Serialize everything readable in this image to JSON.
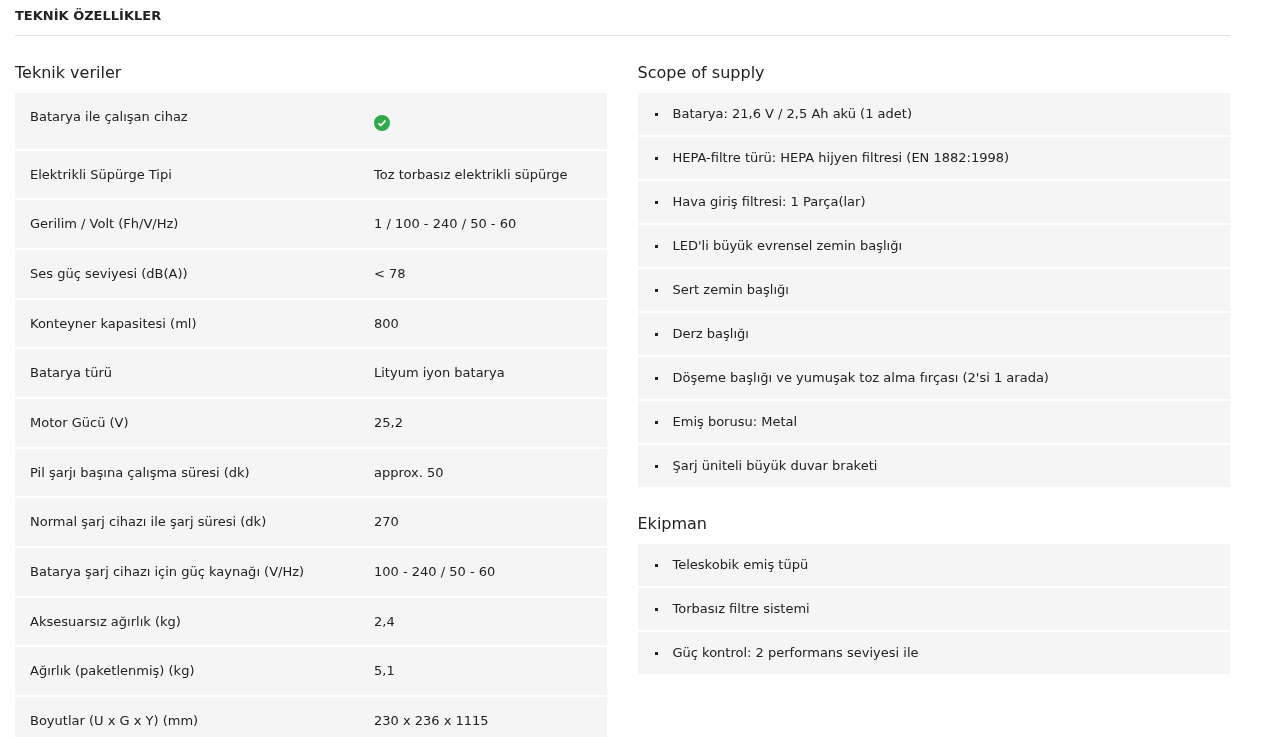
{
  "page_title": "TEKNİK ÖZELLİKLER",
  "technical_data": {
    "title": "Teknik veriler",
    "rows": [
      {
        "label": "Batarya ile çalışan cihaz",
        "kind": "check",
        "checked": true
      },
      {
        "label": "Elektrikli Süpürge Tipi",
        "kind": "text",
        "value": "Toz torbasız elektrikli süpürge"
      },
      {
        "label": "Gerilim / Volt (Fh/V/Hz)",
        "kind": "text",
        "value": "1 / 100 - 240 / 50 - 60"
      },
      {
        "label": "Ses güç seviyesi (dB(A))",
        "kind": "text",
        "value": "< 78"
      },
      {
        "label": "Konteyner kapasitesi (ml)",
        "kind": "text",
        "value": "800"
      },
      {
        "label": "Batarya türü",
        "kind": "text",
        "value": "Lityum iyon batarya"
      },
      {
        "label": "Motor Gücü (V)",
        "kind": "text",
        "value": "25,2"
      },
      {
        "label": "Pil şarjı başına çalışma süresi (dk)",
        "kind": "text",
        "value": "approx. 50"
      },
      {
        "label": "Normal şarj cihazı ile şarj süresi (dk)",
        "kind": "text",
        "value": "270"
      },
      {
        "label": "Batarya şarj cihazı için güç kaynağı (V/Hz)",
        "kind": "text",
        "value": "100 - 240 / 50 - 60"
      },
      {
        "label": "Aksesuarsız ağırlık (kg)",
        "kind": "text",
        "value": "2,4"
      },
      {
        "label": "Ağırlık (paketlenmiş) (kg)",
        "kind": "text",
        "value": "5,1"
      },
      {
        "label": "Boyutlar (U x G x Y) (mm)",
        "kind": "text",
        "value": "230 x 236 x 1115"
      }
    ]
  },
  "scope_of_supply": {
    "title": "Scope of supply",
    "items": [
      "Batarya: 21,6 V / 2,5 Ah akü (1 adet)",
      "HEPA-filtre türü: HEPA hijyen filtresi (EN 1882:1998)",
      "Hava giriş filtresi: 1 Parça(lar)",
      "LED'li büyük evrensel zemin başlığı",
      "Sert zemin başlığı",
      "Derz başlığı",
      "Döşeme başlığı ve yumuşak toz alma fırçası (2'si 1 arada)",
      "Emiş borusu: Metal",
      "Şarj üniteli büyük duvar braketi"
    ]
  },
  "equipment": {
    "title": "Ekipman",
    "items": [
      "Teleskobik emiş tüpü",
      "Torbasız filtre sistemi",
      "Güç kontrol: 2 performans seviyesi ile"
    ]
  }
}
